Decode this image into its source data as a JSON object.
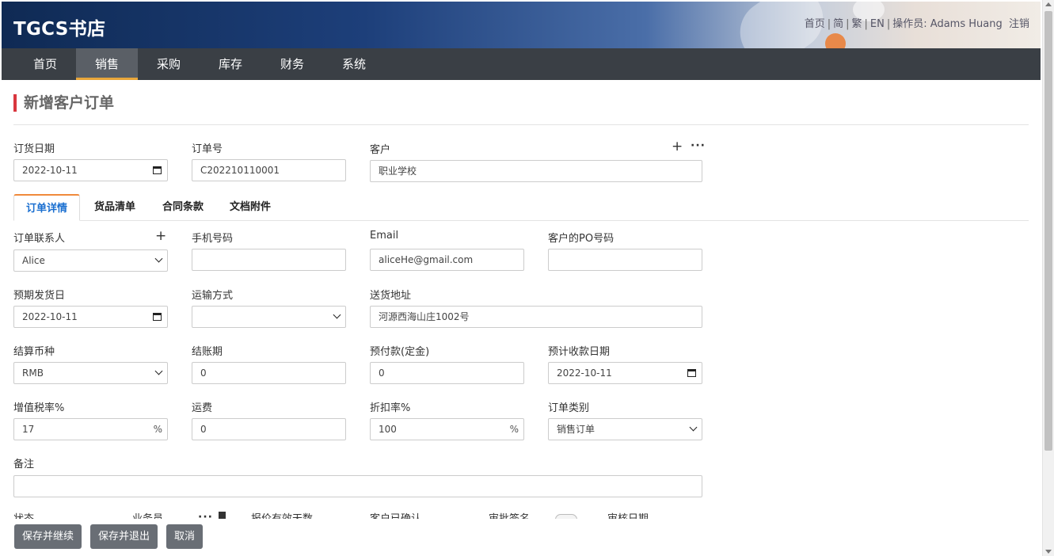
{
  "header": {
    "brand": "TGCS书店",
    "links": [
      "首页",
      "简",
      "繁",
      "EN"
    ],
    "operator_label": "操作员: ",
    "operator_name": "Adams Huang",
    "logout": "注销"
  },
  "nav": {
    "items": [
      "首页",
      "销售",
      "采购",
      "库存",
      "财务",
      "系统"
    ],
    "active": "销售"
  },
  "page": {
    "title": "新增客户订单"
  },
  "top_fields": {
    "order_date_label": "订货日期",
    "order_date_value": "2022-10-11",
    "order_no_label": "订单号",
    "order_no_value": "C202210110001",
    "customer_label": "客户",
    "customer_value": "职业学校"
  },
  "tabs": [
    "订单详情",
    "货品清单",
    "合同条款",
    "文档附件"
  ],
  "detail": {
    "contact_label": "订单联系人",
    "contact_value": "Alice",
    "phone_label": "手机号码",
    "phone_value": "",
    "email_label": "Email",
    "email_value": "aliceHe@gmail.com",
    "po_label": "客户的PO号码",
    "po_value": "",
    "ship_date_label": "预期发货日",
    "ship_date_value": "2022-10-11",
    "shipping_label": "运输方式",
    "shipping_value": "",
    "address_label": "送货地址",
    "address_value": "河源西海山庄1002号",
    "currency_label": "结算币种",
    "currency_value": "RMB",
    "period_label": "结账期",
    "period_value": "0",
    "prepay_label": "预付款(定金)",
    "prepay_value": "0",
    "pay_date_label": "预计收款日期",
    "pay_date_value": "2022-10-11",
    "vat_label": "增值税率%",
    "vat_value": "17",
    "vat_unit": "%",
    "freight_label": "运费",
    "freight_value": "0",
    "discount_label": "折扣率%",
    "discount_value": "100",
    "discount_unit": "%",
    "order_type_label": "订单类别",
    "order_type_value": "销售订单",
    "remark_label": "备注",
    "remark_value": ""
  },
  "clipped_row": [
    "状态",
    "业务员",
    "报价有效天数",
    "客户已确认",
    "审批签名",
    "审核日期"
  ],
  "buttons": {
    "save_continue": "保存并继续",
    "save_exit": "保存并退出",
    "cancel": "取消"
  },
  "colors": {
    "nav_bg": "#3a3f45",
    "accent": "#e8a63a",
    "title_bar": "#d9363e",
    "tab_active": "#1a6fd0",
    "button": "#696e75"
  }
}
